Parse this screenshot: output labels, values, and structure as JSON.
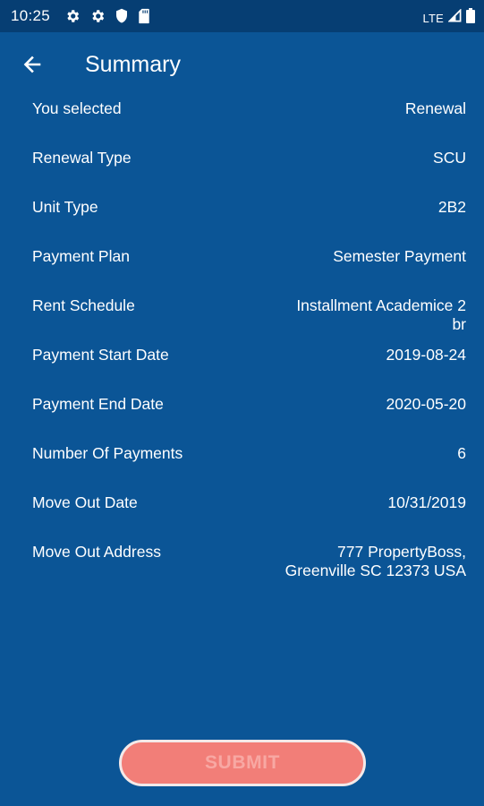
{
  "status_bar": {
    "time": "10:25",
    "network": "LTE",
    "icons": [
      "settings-icon",
      "settings-icon",
      "shield-icon",
      "sd-card-icon",
      "signal-icon",
      "battery-icon"
    ]
  },
  "header": {
    "back_icon": "arrow-left-icon",
    "title": "Summary"
  },
  "summary": {
    "rows": [
      {
        "label": "You selected",
        "value": "Renewal"
      },
      {
        "label": "Renewal Type",
        "value": "SCU"
      },
      {
        "label": "Unit Type",
        "value": "2B2"
      },
      {
        "label": "Payment Plan",
        "value": "Semester Payment"
      },
      {
        "label": "Rent Schedule",
        "value": "Installment Academice 2 br"
      },
      {
        "label": "Payment Start Date",
        "value": "2019-08-24"
      },
      {
        "label": "Payment End Date",
        "value": "2020-05-20"
      },
      {
        "label": "Number Of Payments",
        "value": "6"
      },
      {
        "label": "Move Out Date",
        "value": "10/31/2019"
      },
      {
        "label": "Move Out Address",
        "value": "777 PropertyBoss, Greenville SC 12373 USA"
      }
    ]
  },
  "actions": {
    "submit_label": "SUBMIT"
  },
  "colors": {
    "background": "#0b5596",
    "status_bar": "#063e73",
    "submit_fill": "#f27e78",
    "submit_text": "#f8a8a3"
  }
}
